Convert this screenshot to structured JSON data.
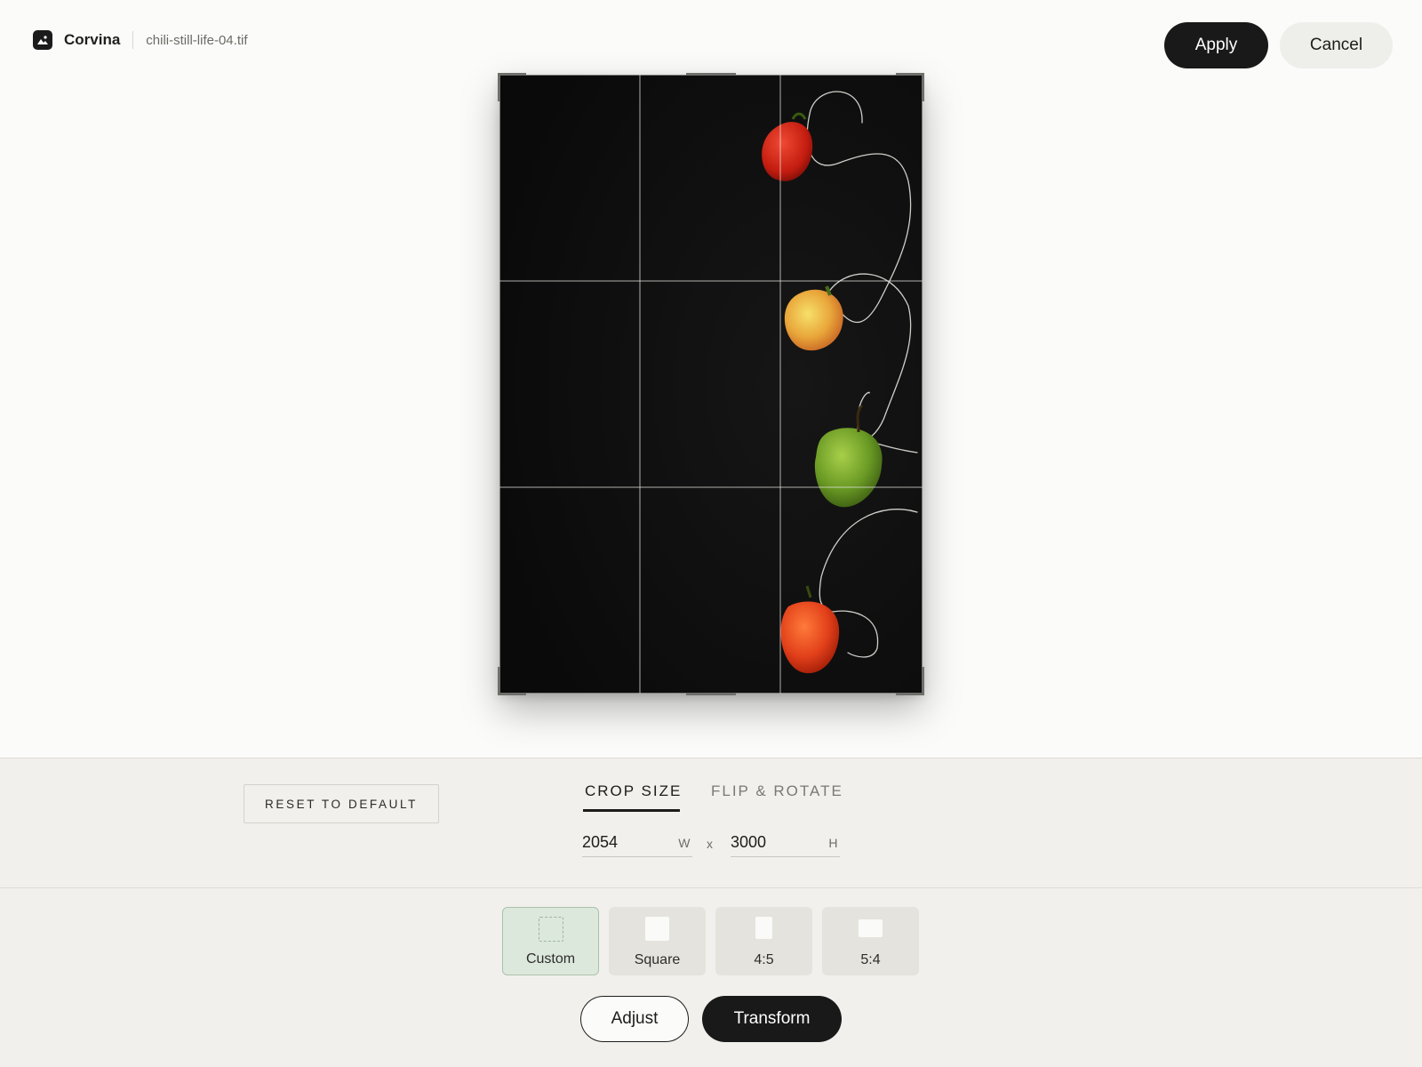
{
  "header": {
    "app_name": "Corvina",
    "file_name": "chili-still-life-04.tif",
    "apply_label": "Apply",
    "cancel_label": "Cancel"
  },
  "canvas": {
    "grid": "rule-of-thirds",
    "colors": {
      "background": "#0d0d0d",
      "red_pepper": "#d42a1a",
      "yellow_pepper": "#e8c23a",
      "green_pepper": "#6fa32a",
      "orange_pepper": "#e8501a"
    }
  },
  "panel": {
    "reset_label": "RESET TO DEFAULT",
    "tabs": [
      {
        "label": "CROP SIZE",
        "active": true
      },
      {
        "label": "FLIP & ROTATE",
        "active": false
      }
    ],
    "width_value": "2054",
    "width_unit": "W",
    "separator": "x",
    "height_value": "3000",
    "height_unit": "H",
    "presets": [
      {
        "label": "Custom",
        "icon": "dashed-square-icon",
        "active": true
      },
      {
        "label": "Square",
        "icon": "square-icon",
        "active": false
      },
      {
        "label": "4:5",
        "icon": "portrait-rect-icon",
        "active": false
      },
      {
        "label": "5:4",
        "icon": "landscape-rect-icon",
        "active": false
      }
    ],
    "mode_buttons": {
      "adjust_label": "Adjust",
      "transform_label": "Transform"
    }
  },
  "colors": {
    "accent_dark": "#191919",
    "preset_active_bg": "#dde8dd",
    "preset_active_border": "#a9c3ab"
  }
}
